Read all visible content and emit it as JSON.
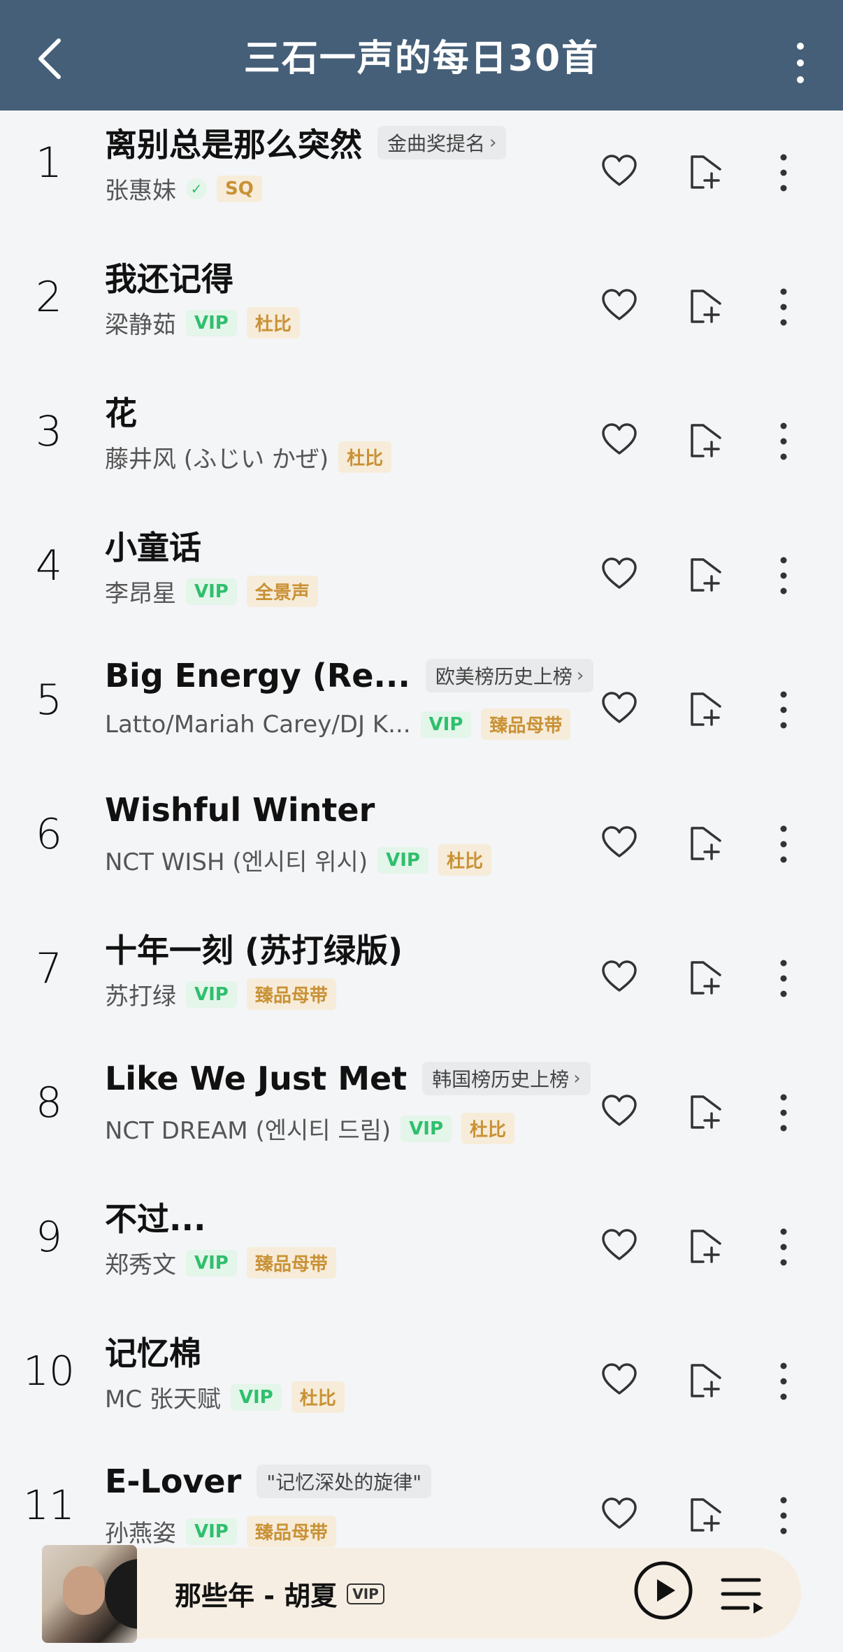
{
  "header": {
    "title": "三石一声的每日30首",
    "back_icon": "chevron-left-icon",
    "more_icon": "more-vertical-icon"
  },
  "songs": [
    {
      "num": "1",
      "title": "离别总是那么突然",
      "rank_tag": "金曲奖提名",
      "artist": "张惠妹",
      "verified": true,
      "badges": [
        {
          "text": "SQ",
          "kind": "gold"
        }
      ]
    },
    {
      "num": "2",
      "title": "我还记得",
      "rank_tag": "",
      "artist": "梁静茹",
      "badges": [
        {
          "text": "VIP",
          "kind": "vip"
        },
        {
          "text": "杜比",
          "kind": "gold"
        }
      ]
    },
    {
      "num": "3",
      "title": "花",
      "rank_tag": "",
      "artist": "藤井风 (ふじい かぜ)",
      "badges": [
        {
          "text": "杜比",
          "kind": "gold"
        }
      ]
    },
    {
      "num": "4",
      "title": "小童话",
      "rank_tag": "",
      "artist": "李昂星",
      "badges": [
        {
          "text": "VIP",
          "kind": "vip"
        },
        {
          "text": "全景声",
          "kind": "gold"
        }
      ]
    },
    {
      "num": "5",
      "title": "Big Energy (Re...",
      "rank_tag": "欧美榜历史上榜",
      "artist": "Latto/Mariah Carey/DJ K...",
      "badges": [
        {
          "text": "VIP",
          "kind": "vip"
        },
        {
          "text": "臻品母带",
          "kind": "gold"
        }
      ]
    },
    {
      "num": "6",
      "title": "Wishful Winter",
      "rank_tag": "",
      "artist": "NCT WISH (엔시티 위시)",
      "badges": [
        {
          "text": "VIP",
          "kind": "vip"
        },
        {
          "text": "杜比",
          "kind": "gold"
        }
      ]
    },
    {
      "num": "7",
      "title": "十年一刻 (苏打绿版)",
      "rank_tag": "",
      "artist": "苏打绿",
      "badges": [
        {
          "text": "VIP",
          "kind": "vip"
        },
        {
          "text": "臻品母带",
          "kind": "gold"
        }
      ]
    },
    {
      "num": "8",
      "title": "Like We Just Met",
      "rank_tag": "韩国榜历史上榜",
      "artist": "NCT DREAM (엔시티 드림)",
      "badges": [
        {
          "text": "VIP",
          "kind": "vip"
        },
        {
          "text": "杜比",
          "kind": "gold"
        }
      ]
    },
    {
      "num": "9",
      "title": "不过...",
      "rank_tag": "",
      "artist": "郑秀文",
      "badges": [
        {
          "text": "VIP",
          "kind": "vip"
        },
        {
          "text": "臻品母带",
          "kind": "gold"
        }
      ]
    },
    {
      "num": "10",
      "title": "记忆棉",
      "rank_tag": "",
      "artist": "MC 张天赋",
      "badges": [
        {
          "text": "VIP",
          "kind": "vip"
        },
        {
          "text": "杜比",
          "kind": "gold"
        }
      ]
    },
    {
      "num": "11",
      "title": "E-Lover",
      "rank_tag": "\"记忆深处的旋律\"",
      "rank_no_chevron": true,
      "artist": "孙燕姿",
      "badges": [
        {
          "text": "VIP",
          "kind": "vip"
        },
        {
          "text": "臻品母带",
          "kind": "gold"
        }
      ]
    }
  ],
  "player": {
    "now_playing": "那些年 - 胡夏",
    "vip_label": "VIP",
    "play_icon": "play-icon",
    "queue_icon": "playlist-icon"
  },
  "colors": {
    "header_bg": "#455f78",
    "vip_green": "#2fbf6d",
    "gold": "#c99135",
    "player_bg": "#f6eee3"
  }
}
